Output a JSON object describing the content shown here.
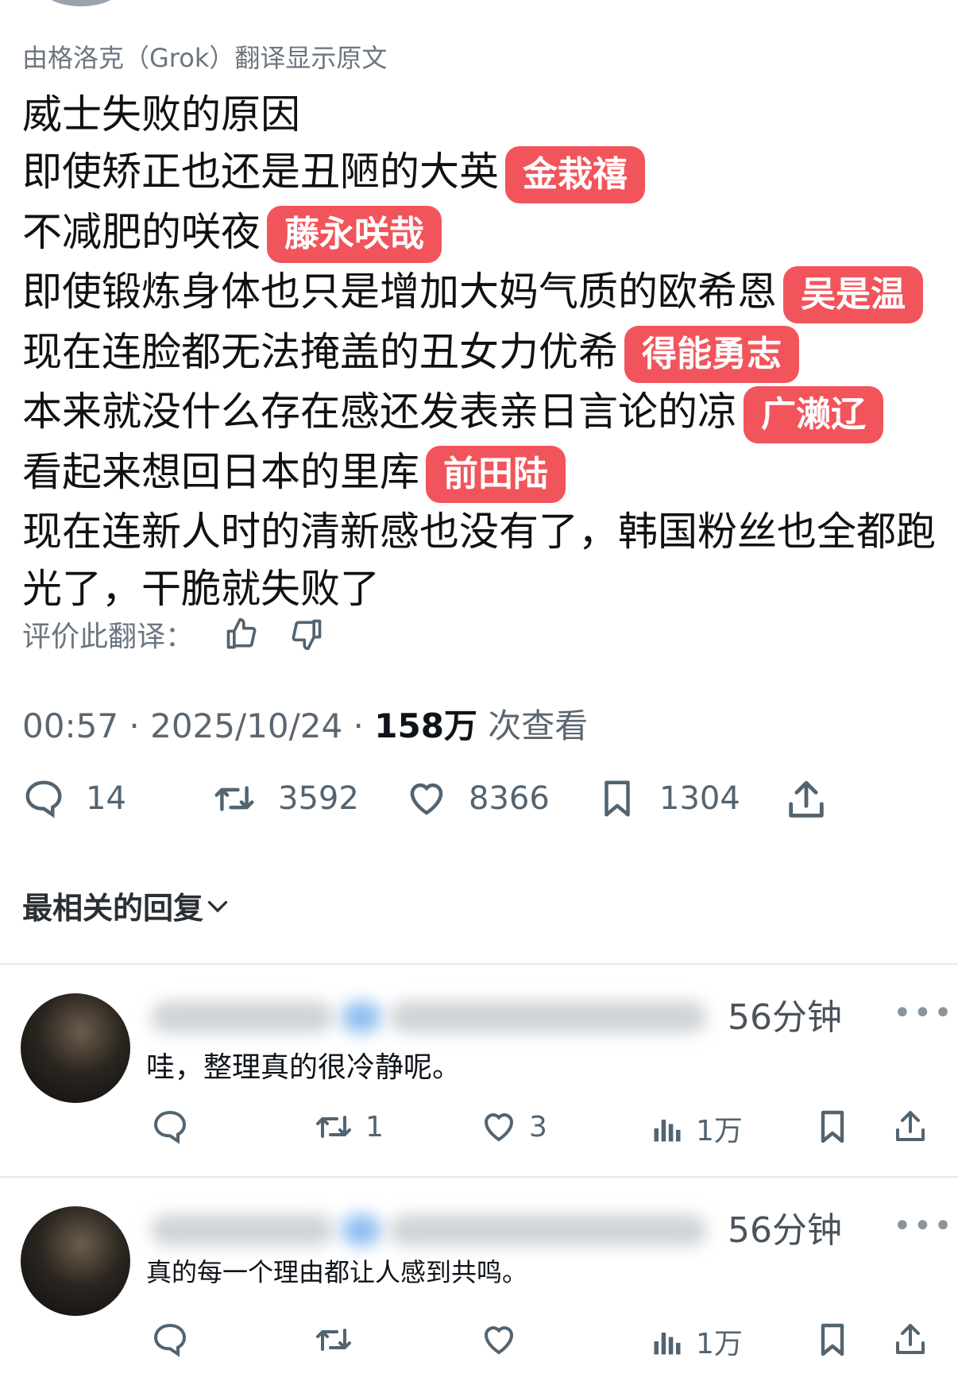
{
  "tweet": {
    "translation_note": "由格洛克（Grok）翻译显示原文",
    "lines": [
      {
        "text": "威士失败的原因",
        "tag": ""
      },
      {
        "text": "即使矫正也还是丑陋的大英",
        "tag": "金栽禧"
      },
      {
        "text": "不减肥的咲夜",
        "tag": "藤永咲哉"
      },
      {
        "text": "即使锻炼身体也只是增加大妈气质的欧希恩",
        "tag": "吴是温"
      },
      {
        "text": "现在连脸都无法掩盖的丑女力优希",
        "tag": "得能勇志"
      },
      {
        "text": "本来就没什么存在感还发表亲日言论的凉",
        "tag": "广濑辽"
      },
      {
        "text": "看起来想回日本的里库",
        "tag": "前田陆"
      },
      {
        "text": "现在连新人时的清新感也没有了，韩国粉丝也全都跑光了，干脆就失败了",
        "tag": ""
      }
    ],
    "rate_label": "评价此翻译：",
    "time": "00:57",
    "date": "2025/10/24",
    "views_count": "158万",
    "views_label": "次查看",
    "stats": {
      "replies": "14",
      "reposts": "3592",
      "likes": "8366",
      "bookmarks": "1304"
    }
  },
  "sort_label": "最相关的回复",
  "replies": [
    {
      "time": "56分钟",
      "more": "•••",
      "text": "哇，整理真的很冷静呢。",
      "reposts": "1",
      "likes": "3",
      "views": "1万"
    },
    {
      "time": "56分钟",
      "more": "•••",
      "text": "真的每一个理由都让人感到共鸣。",
      "reposts": "",
      "likes": "",
      "views": "1万"
    }
  ],
  "colors": {
    "tag_bg": "#f2545b",
    "secondary_text": "#536471"
  }
}
